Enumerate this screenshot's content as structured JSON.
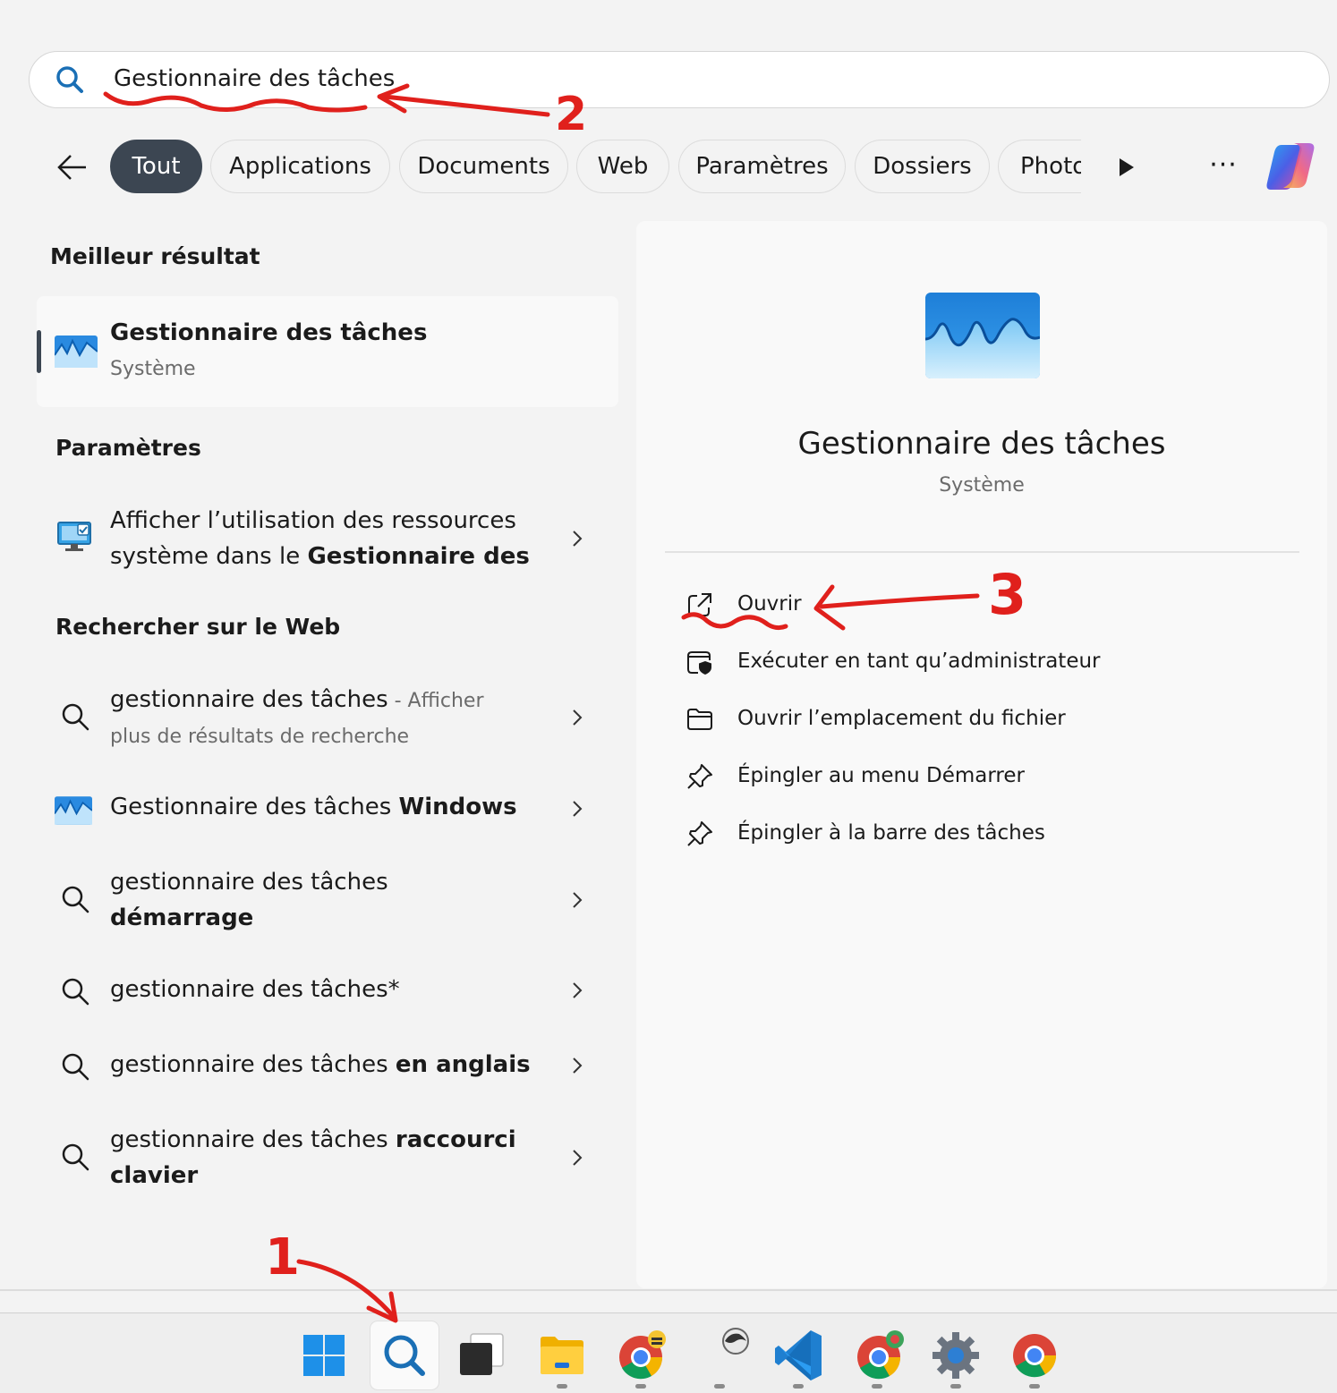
{
  "search": {
    "query": "Gestionnaire des tâches"
  },
  "filters": {
    "back_label": "",
    "chips": [
      "Tout",
      "Applications",
      "Documents",
      "Web",
      "Paramètres",
      "Dossiers",
      "Photo"
    ],
    "more_label": "···"
  },
  "left": {
    "best_title": "Meilleur résultat",
    "best": {
      "title": "Gestionnaire des tâches",
      "subtitle": "Système"
    },
    "settings_title": "Paramètres",
    "settings_item": {
      "line1": "Afficher l’utilisation des ressources",
      "line2_normal": "système dans le ",
      "line2_bold": "Gestionnaire des"
    },
    "web_title": "Rechercher sur le Web",
    "web_items": [
      {
        "normal": "gestionnaire des tâches",
        "extra": " - Afficher",
        "line2": "plus de résultats de recherche"
      },
      {
        "normal": "Gestionnaire des tâches ",
        "bold": "Windows"
      },
      {
        "normal": "gestionnaire des tâches",
        "line2_bold": "démarrage"
      },
      {
        "normal": "gestionnaire des tâches*"
      },
      {
        "normal": "gestionnaire des tâches ",
        "bold": "en anglais"
      },
      {
        "normal": "gestionnaire des tâches ",
        "bold": "raccourci",
        "line2_bold": "clavier"
      }
    ]
  },
  "right": {
    "title": "Gestionnaire des tâches",
    "subtitle": "Système",
    "actions": [
      {
        "label": "Ouvrir",
        "icon": "open-external-icon"
      },
      {
        "label": "Exécuter en tant qu’administrateur",
        "icon": "shield-window-icon"
      },
      {
        "label": "Ouvrir l’emplacement du fichier",
        "icon": "folder-icon"
      },
      {
        "label": "Épingler au menu Démarrer",
        "icon": "pin-icon"
      },
      {
        "label": "Épingler à la barre des tâches",
        "icon": "pin-icon"
      }
    ]
  },
  "annotations": {
    "one": "1",
    "two": "2",
    "three": "3"
  },
  "taskbar": {
    "items": [
      "start-icon",
      "search-icon",
      "task-view-icon",
      "file-explorer-icon",
      "chrome-icon",
      "app-icon",
      "vscode-icon",
      "chrome-icon",
      "settings-icon",
      "chrome-icon"
    ]
  },
  "colors": {
    "accent": "#3c4652",
    "annotation_red": "#e0201c",
    "chrome_red": "#db4437",
    "chrome_yellow": "#f4b400",
    "chrome_green": "#0f9d58",
    "chrome_blue": "#4285f4"
  }
}
